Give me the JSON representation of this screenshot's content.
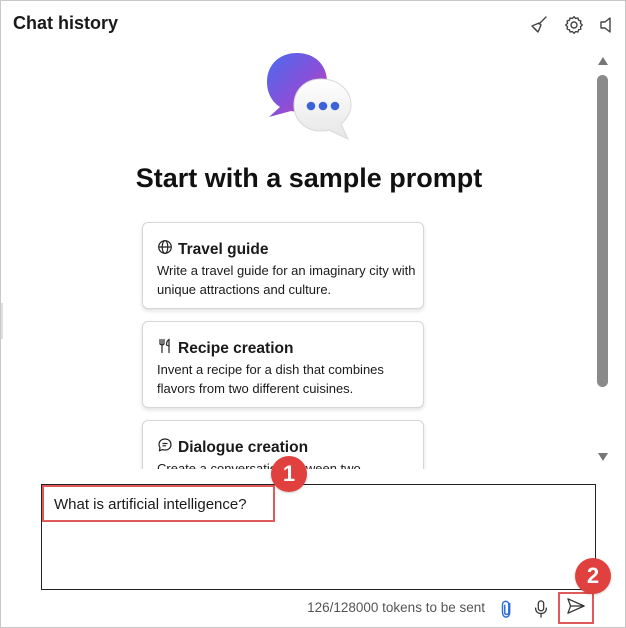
{
  "header": {
    "title": "Chat history",
    "icons": [
      "broom-icon",
      "settings-gear-icon",
      "speaker-icon"
    ]
  },
  "main": {
    "heading": "Start with a sample prompt",
    "prompts": [
      {
        "icon": "globe-icon",
        "title": "Travel guide",
        "description": "Write a travel guide for an imaginary city with unique attractions and culture."
      },
      {
        "icon": "fork-knife-icon",
        "title": "Recipe creation",
        "description": "Invent a recipe for a dish that combines flavors from two different cuisines."
      },
      {
        "icon": "chat-bubble-icon",
        "title": "Dialogue creation",
        "description": "Create a conversation between two"
      }
    ]
  },
  "input": {
    "value": "What is artificial intelligence?"
  },
  "footer": {
    "tokens_text": "126/128000 tokens to be sent",
    "icons": [
      "attach-icon",
      "microphone-icon",
      "send-icon"
    ]
  },
  "annotations": [
    "1",
    "2"
  ],
  "colors": {
    "accent": "#e0413e",
    "highlight_border": "#e15a5a",
    "brand_gradient_start": "#5b5bd6",
    "brand_gradient_end": "#c93fb6"
  }
}
